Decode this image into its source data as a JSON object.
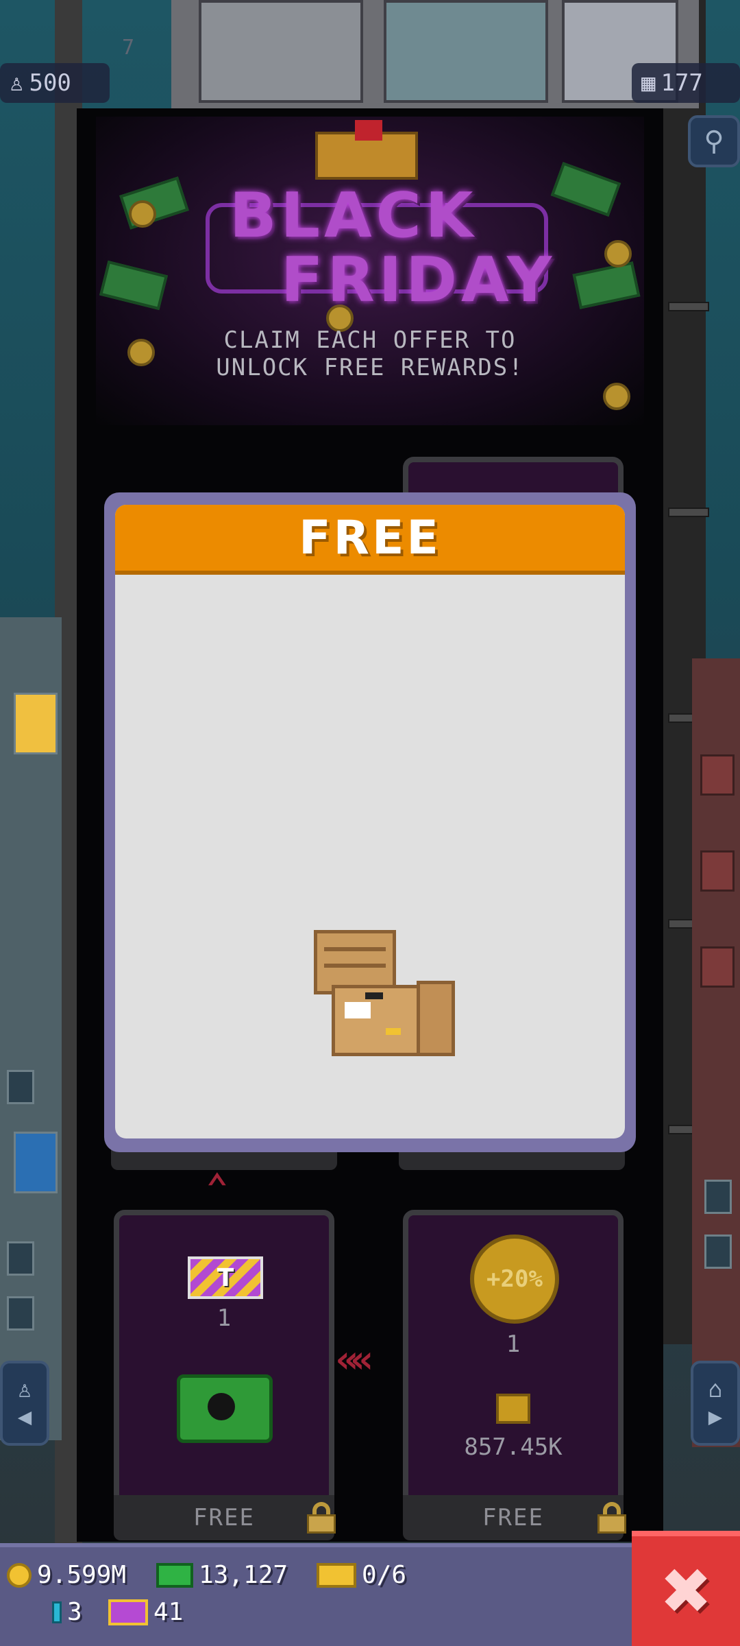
{
  "hud": {
    "population": "500",
    "floors": "177",
    "floor_number": "7"
  },
  "banner": {
    "title_line1": "BLACK",
    "title_line2": "FRIDAY",
    "subtitle_line1": "CLAIM EACH OFFER TO",
    "subtitle_line2": "UNLOCK FREE REWARDS!"
  },
  "popup": {
    "header": "FREE",
    "reward_icon": "crate-chest-icon"
  },
  "offers": [
    {
      "reward_qty": "1",
      "reward_icon": "ticket-icon",
      "prize_icon": "green-chest-icon",
      "button": "FREE"
    },
    {
      "reward_qty": "1",
      "reward_icon": "boost-coin-icon",
      "boost_label": "+20%",
      "coins_value": "857.45K",
      "button": "FREE"
    }
  ],
  "resources": {
    "coins": "9.599M",
    "cash": "13,127",
    "tickets": "0/6",
    "bux": "3",
    "golden_tickets": "41"
  },
  "colors": {
    "popup_header": "#ec8b00",
    "popup_border": "#7a73a8",
    "bottom_bar": "#5a5a85",
    "close_button": "#e03838"
  }
}
